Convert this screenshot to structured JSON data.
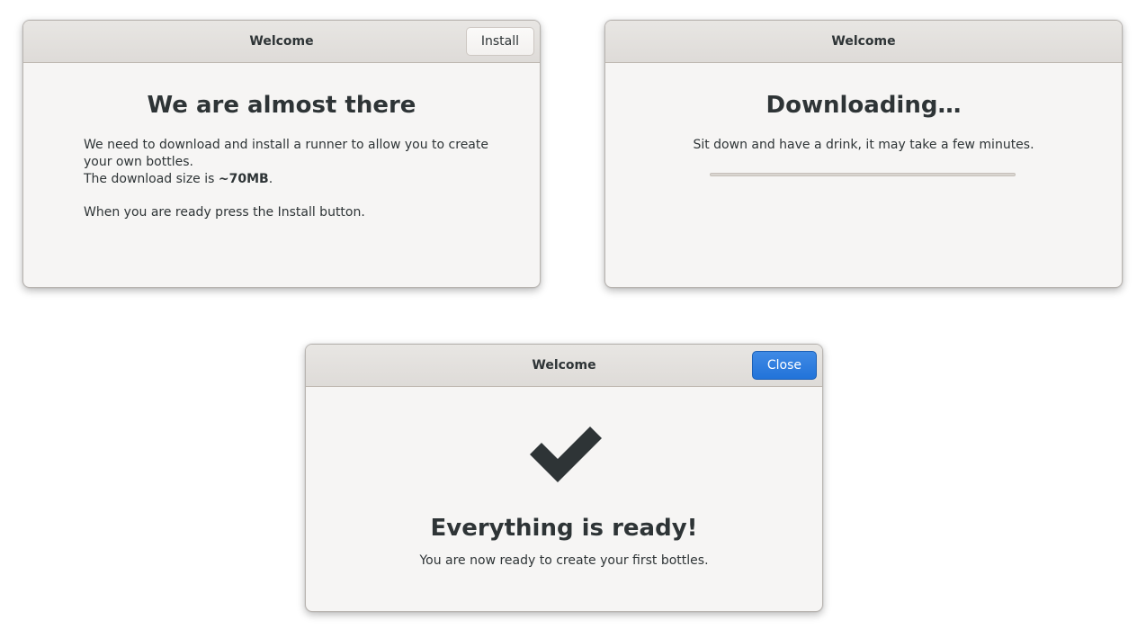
{
  "install_dialog": {
    "title": "Welcome",
    "install_button": "Install",
    "heading": "We are almost there",
    "line1": "We need to download and install a runner to allow you to create your own bottles.",
    "size_prefix": "The download size is ",
    "size_value": "~70MB",
    "size_suffix": ".",
    "ready_text": "When you are ready press the Install button."
  },
  "downloading_dialog": {
    "title": "Welcome",
    "heading": "Downloading…",
    "subtitle": "Sit down and have a drink, it may take a few minutes.",
    "progress": 0
  },
  "ready_dialog": {
    "title": "Welcome",
    "close_button": "Close",
    "icon": "checkmark-icon",
    "heading": "Everything is ready!",
    "subtitle": "You are now ready to create your first bottles."
  },
  "colors": {
    "accent": "#3584e4",
    "window_bg": "#f6f5f4",
    "headerbar_bg": "#e1dedb",
    "text": "#2e3436"
  }
}
